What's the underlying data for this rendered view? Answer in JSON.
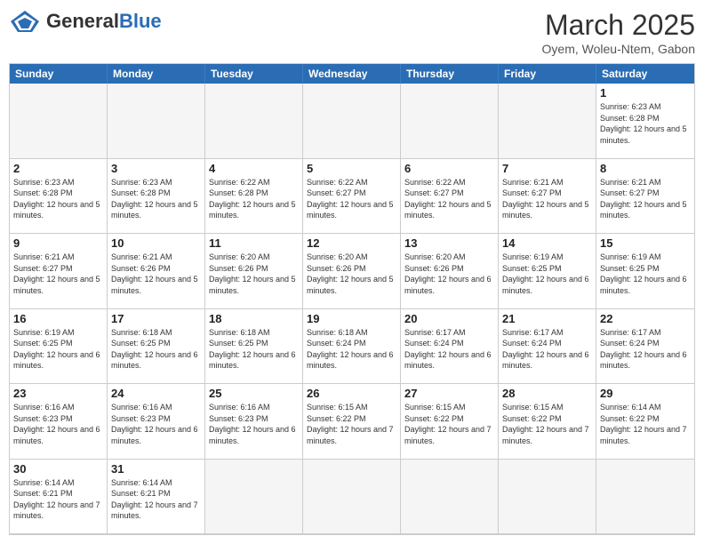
{
  "header": {
    "logo_general": "General",
    "logo_blue": "Blue",
    "month_year": "March 2025",
    "location": "Oyem, Woleu-Ntem, Gabon"
  },
  "days": [
    "Sunday",
    "Monday",
    "Tuesday",
    "Wednesday",
    "Thursday",
    "Friday",
    "Saturday"
  ],
  "weeks": [
    [
      {
        "date": "",
        "info": ""
      },
      {
        "date": "",
        "info": ""
      },
      {
        "date": "",
        "info": ""
      },
      {
        "date": "",
        "info": ""
      },
      {
        "date": "",
        "info": ""
      },
      {
        "date": "",
        "info": ""
      },
      {
        "date": "1",
        "info": "Sunrise: 6:23 AM\nSunset: 6:28 PM\nDaylight: 12 hours and 5 minutes."
      }
    ],
    [
      {
        "date": "2",
        "info": "Sunrise: 6:23 AM\nSunset: 6:28 PM\nDaylight: 12 hours and 5 minutes."
      },
      {
        "date": "3",
        "info": "Sunrise: 6:23 AM\nSunset: 6:28 PM\nDaylight: 12 hours and 5 minutes."
      },
      {
        "date": "4",
        "info": "Sunrise: 6:22 AM\nSunset: 6:28 PM\nDaylight: 12 hours and 5 minutes."
      },
      {
        "date": "5",
        "info": "Sunrise: 6:22 AM\nSunset: 6:27 PM\nDaylight: 12 hours and 5 minutes."
      },
      {
        "date": "6",
        "info": "Sunrise: 6:22 AM\nSunset: 6:27 PM\nDaylight: 12 hours and 5 minutes."
      },
      {
        "date": "7",
        "info": "Sunrise: 6:21 AM\nSunset: 6:27 PM\nDaylight: 12 hours and 5 minutes."
      },
      {
        "date": "8",
        "info": "Sunrise: 6:21 AM\nSunset: 6:27 PM\nDaylight: 12 hours and 5 minutes."
      }
    ],
    [
      {
        "date": "9",
        "info": "Sunrise: 6:21 AM\nSunset: 6:27 PM\nDaylight: 12 hours and 5 minutes."
      },
      {
        "date": "10",
        "info": "Sunrise: 6:21 AM\nSunset: 6:26 PM\nDaylight: 12 hours and 5 minutes."
      },
      {
        "date": "11",
        "info": "Sunrise: 6:20 AM\nSunset: 6:26 PM\nDaylight: 12 hours and 5 minutes."
      },
      {
        "date": "12",
        "info": "Sunrise: 6:20 AM\nSunset: 6:26 PM\nDaylight: 12 hours and 5 minutes."
      },
      {
        "date": "13",
        "info": "Sunrise: 6:20 AM\nSunset: 6:26 PM\nDaylight: 12 hours and 6 minutes."
      },
      {
        "date": "14",
        "info": "Sunrise: 6:19 AM\nSunset: 6:25 PM\nDaylight: 12 hours and 6 minutes."
      },
      {
        "date": "15",
        "info": "Sunrise: 6:19 AM\nSunset: 6:25 PM\nDaylight: 12 hours and 6 minutes."
      }
    ],
    [
      {
        "date": "16",
        "info": "Sunrise: 6:19 AM\nSunset: 6:25 PM\nDaylight: 12 hours and 6 minutes."
      },
      {
        "date": "17",
        "info": "Sunrise: 6:18 AM\nSunset: 6:25 PM\nDaylight: 12 hours and 6 minutes."
      },
      {
        "date": "18",
        "info": "Sunrise: 6:18 AM\nSunset: 6:25 PM\nDaylight: 12 hours and 6 minutes."
      },
      {
        "date": "19",
        "info": "Sunrise: 6:18 AM\nSunset: 6:24 PM\nDaylight: 12 hours and 6 minutes."
      },
      {
        "date": "20",
        "info": "Sunrise: 6:17 AM\nSunset: 6:24 PM\nDaylight: 12 hours and 6 minutes."
      },
      {
        "date": "21",
        "info": "Sunrise: 6:17 AM\nSunset: 6:24 PM\nDaylight: 12 hours and 6 minutes."
      },
      {
        "date": "22",
        "info": "Sunrise: 6:17 AM\nSunset: 6:24 PM\nDaylight: 12 hours and 6 minutes."
      }
    ],
    [
      {
        "date": "23",
        "info": "Sunrise: 6:16 AM\nSunset: 6:23 PM\nDaylight: 12 hours and 6 minutes."
      },
      {
        "date": "24",
        "info": "Sunrise: 6:16 AM\nSunset: 6:23 PM\nDaylight: 12 hours and 6 minutes."
      },
      {
        "date": "25",
        "info": "Sunrise: 6:16 AM\nSunset: 6:23 PM\nDaylight: 12 hours and 6 minutes."
      },
      {
        "date": "26",
        "info": "Sunrise: 6:15 AM\nSunset: 6:22 PM\nDaylight: 12 hours and 7 minutes."
      },
      {
        "date": "27",
        "info": "Sunrise: 6:15 AM\nSunset: 6:22 PM\nDaylight: 12 hours and 7 minutes."
      },
      {
        "date": "28",
        "info": "Sunrise: 6:15 AM\nSunset: 6:22 PM\nDaylight: 12 hours and 7 minutes."
      },
      {
        "date": "29",
        "info": "Sunrise: 6:14 AM\nSunset: 6:22 PM\nDaylight: 12 hours and 7 minutes."
      }
    ],
    [
      {
        "date": "30",
        "info": "Sunrise: 6:14 AM\nSunset: 6:21 PM\nDaylight: 12 hours and 7 minutes."
      },
      {
        "date": "31",
        "info": "Sunrise: 6:14 AM\nSunset: 6:21 PM\nDaylight: 12 hours and 7 minutes."
      },
      {
        "date": "",
        "info": ""
      },
      {
        "date": "",
        "info": ""
      },
      {
        "date": "",
        "info": ""
      },
      {
        "date": "",
        "info": ""
      },
      {
        "date": "",
        "info": ""
      }
    ]
  ]
}
